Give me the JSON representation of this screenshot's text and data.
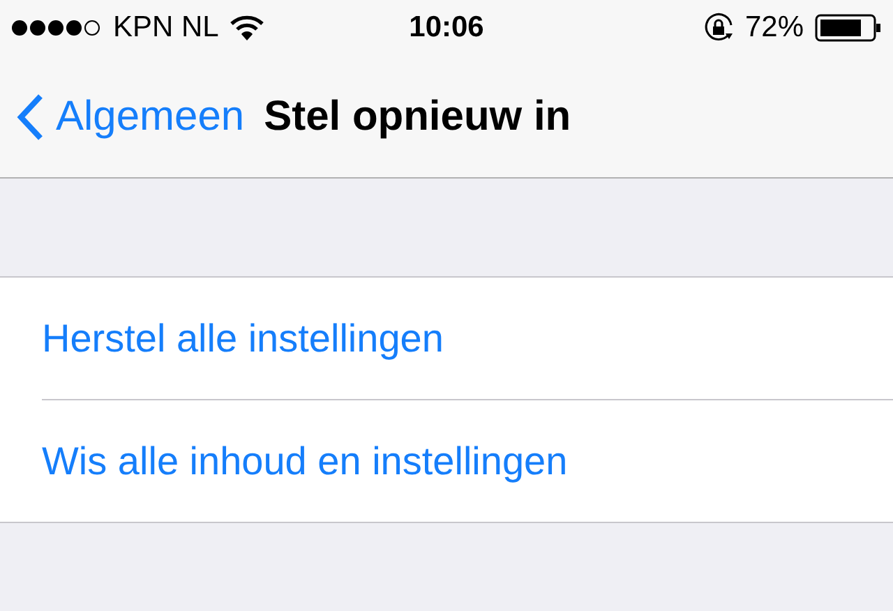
{
  "status_bar": {
    "carrier": "KPN NL",
    "time": "10:06",
    "battery": "72%"
  },
  "nav_bar": {
    "back": "Algemeen",
    "title": "Stel opnieuw in"
  },
  "rows": [
    {
      "label": "Herstel alle instellingen"
    },
    {
      "label": "Wis alle inhoud en instellingen"
    }
  ]
}
